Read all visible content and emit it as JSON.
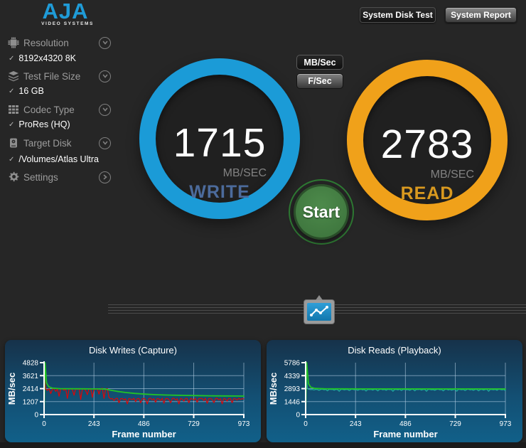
{
  "header": {
    "logo_text": "AJA",
    "logo_subtext": "VIDEO SYSTEMS",
    "system_disk_test": "System Disk Test",
    "system_report": "System Report"
  },
  "sidebar": {
    "check_glyph": "✓",
    "items": [
      {
        "label": "Resolution",
        "value": "8192x4320 8K",
        "icon": "chip-icon",
        "chevron": "down"
      },
      {
        "label": "Test File Size",
        "value": "16 GB",
        "icon": "layers-icon",
        "chevron": "down"
      },
      {
        "label": "Codec Type",
        "value": "ProRes (HQ)",
        "icon": "codec-grid-icon",
        "chevron": "down"
      },
      {
        "label": "Target Disk",
        "value": "/Volumes/Atlas Ultra",
        "icon": "disk-icon",
        "chevron": "down"
      },
      {
        "label": "Settings",
        "value": null,
        "icon": "gear-icon",
        "chevron": "right"
      }
    ]
  },
  "gauges": {
    "write": {
      "value": "1715",
      "unit": "MB/SEC",
      "label": "WRITE",
      "ring_color": "#1b9bd7",
      "label_color": "#4c6b9c"
    },
    "read": {
      "value": "2783",
      "unit": "MB/SEC",
      "label": "READ",
      "ring_color": "#f0a11a",
      "label_color": "#d9991f"
    }
  },
  "controls": {
    "mb_sec_label": "MB/Sec",
    "f_sec_label": "F/Sec",
    "start_label": "Start"
  },
  "chart_data": [
    {
      "type": "line",
      "title": "Disk Writes (Capture)",
      "xlabel": "Frame number",
      "ylabel": "MB/sec",
      "xlim": [
        0,
        973
      ],
      "ylim": [
        0,
        4828
      ],
      "xticks": [
        0,
        243,
        486,
        729,
        973
      ],
      "yticks": [
        0,
        1207,
        2414,
        3621,
        4828
      ],
      "grid": true,
      "legend": "none",
      "series": [
        {
          "name": "instantaneous-write",
          "color": "#e00505",
          "width": 1.2,
          "even_x": true,
          "values": [
            4750,
            2380,
            2250,
            2400,
            1950,
            2350,
            2420,
            2150,
            2400,
            1700,
            2380,
            2430,
            2250,
            2400,
            1500,
            2350,
            2420,
            2300,
            1800,
            2400,
            2350,
            2430,
            1400,
            2380,
            2420,
            2250,
            1850,
            2400,
            2430,
            1600,
            2380,
            2350,
            2420,
            1900,
            2400,
            2450,
            1500,
            2380,
            2420,
            1600,
            1450,
            1500,
            1300,
            1480,
            1520,
            1100,
            1470,
            1500,
            1350,
            1480,
            1000,
            1500,
            1450,
            1380,
            1520,
            1200,
            1480,
            1500,
            1100,
            1460,
            1510,
            1400,
            1000,
            1490,
            1520,
            1350,
            1480,
            1150,
            1500,
            1460,
            1300,
            1520,
            1050,
            1480,
            1500,
            1400,
            1100,
            1490,
            1520,
            1350,
            1480,
            1000,
            1500,
            1450,
            1250,
            1510,
            1480,
            1100,
            1500,
            1460,
            1350,
            1520,
            1150,
            1490,
            1500,
            1480,
            1300,
            1520,
            1050,
            1480,
            1500,
            1400,
            1100,
            1490,
            1520,
            1350,
            1480,
            1000,
            1500,
            1450,
            1250,
            1510,
            1480,
            1100,
            1500,
            1460,
            1350,
            1520,
            1400,
            1480,
            1450
          ]
        },
        {
          "name": "average-write",
          "color": "#22c425",
          "width": 1.8,
          "points": [
            [
              0,
              0
            ],
            [
              5,
              4828
            ],
            [
              12,
              2950
            ],
            [
              22,
              2600
            ],
            [
              40,
              2460
            ],
            [
              80,
              2410
            ],
            [
              140,
              2400
            ],
            [
              200,
              2395
            ],
            [
              260,
              2385
            ],
            [
              300,
              2370
            ],
            [
              325,
              2270
            ],
            [
              355,
              2160
            ],
            [
              395,
              2060
            ],
            [
              440,
              1970
            ],
            [
              495,
              1895
            ],
            [
              550,
              1845
            ],
            [
              610,
              1810
            ],
            [
              675,
              1785
            ],
            [
              740,
              1765
            ],
            [
              810,
              1748
            ],
            [
              880,
              1735
            ],
            [
              930,
              1727
            ],
            [
              973,
              1722
            ]
          ]
        }
      ]
    },
    {
      "type": "line",
      "title": "Disk Reads (Playback)",
      "xlabel": "Frame number",
      "ylabel": "MB/sec",
      "xlim": [
        0,
        973
      ],
      "ylim": [
        0,
        5786
      ],
      "xticks": [
        0,
        243,
        486,
        729,
        973
      ],
      "yticks": [
        0,
        1446,
        2893,
        4339,
        5786
      ],
      "grid": true,
      "legend": "none",
      "series": [
        {
          "name": "instantaneous-read",
          "color": "#1fb3a0",
          "width": 1.2,
          "even_x": true,
          "values": [
            5600,
            2900,
            2820,
            2780,
            2800,
            2750,
            2810,
            2790,
            2700,
            2800,
            2820,
            2760,
            2800,
            2650,
            2810,
            2790,
            2800,
            2720,
            2800,
            2780,
            2600,
            2800,
            2810,
            2750,
            2790,
            2800,
            2680,
            2800,
            2820,
            2760,
            2800,
            2700,
            2790,
            2810,
            2750,
            2800,
            2620,
            2800,
            2780,
            2800,
            2730,
            2810,
            2790,
            2650,
            2800,
            2820,
            2760,
            2800,
            2700,
            2810,
            2780,
            2800,
            2600,
            2790,
            2800,
            2750,
            2820,
            2680,
            2800,
            2810,
            2760,
            2790,
            2700,
            2800,
            2820,
            2650,
            2800,
            2780,
            2810,
            2730,
            2790,
            2800,
            2600,
            2810,
            2800,
            2750,
            2780,
            2700,
            2800,
            2820,
            2760,
            2790,
            2650,
            2800,
            2810,
            2740,
            2800,
            2720,
            2780,
            2800,
            2600,
            2810,
            2790,
            2760,
            2800,
            2680,
            2800,
            2820,
            2750,
            2790,
            2700,
            2800,
            2810,
            2650,
            2780,
            2800,
            2730,
            2790,
            2810,
            2600,
            2800,
            2780,
            2760,
            2800,
            2700,
            2820,
            2790,
            2750,
            2800,
            2680
          ]
        },
        {
          "name": "average-read",
          "color": "#22c425",
          "width": 1.8,
          "points": [
            [
              0,
              0
            ],
            [
              5,
              5786
            ],
            [
              14,
              3450
            ],
            [
              25,
              3050
            ],
            [
              45,
              2920
            ],
            [
              90,
              2880
            ],
            [
              180,
              2870
            ],
            [
              350,
              2865
            ],
            [
              550,
              2862
            ],
            [
              750,
              2858
            ],
            [
              973,
              2856
            ]
          ]
        }
      ]
    }
  ]
}
